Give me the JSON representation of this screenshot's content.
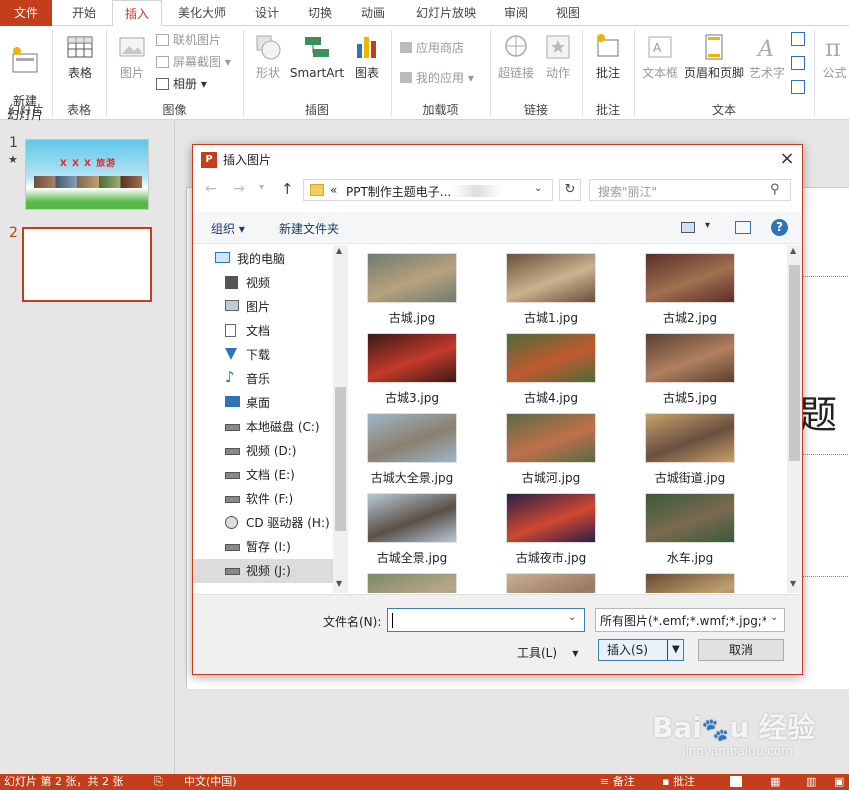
{
  "ribbon": {
    "tabs": [
      "文件",
      "开始",
      "插入",
      "美化大师",
      "设计",
      "切换",
      "动画",
      "幻灯片放映",
      "审阅",
      "视图"
    ],
    "buttons": {
      "new_slide": "新建\n幻灯片",
      "table": "表格",
      "picture": "图片",
      "online_picture": "联机图片",
      "screenshot": "屏幕截图",
      "album": "相册",
      "shapes": "形状",
      "smartart": "SmartArt",
      "chart": "图表",
      "app_store": "应用商店",
      "my_apps": "我的应用",
      "hyperlink": "超链接",
      "action": "动作",
      "comment": "批注",
      "textbox": "文本框",
      "header_footer": "页眉和页脚",
      "wordart": "艺术字",
      "formula": "公式"
    },
    "groups": [
      "幻灯片",
      "表格",
      "图像",
      "插图",
      "加载项",
      "链接",
      "批注",
      "文本"
    ]
  },
  "slides": {
    "thumb1_title": "X X X 旅游",
    "numbers": [
      "1",
      "2"
    ]
  },
  "editor": {
    "title_fragment": "题"
  },
  "dialog": {
    "title": "插入图片",
    "path_prefix": "«",
    "path": "PPT制作主题电子...",
    "search_placeholder": "搜索\"丽江\"",
    "organize": "组织",
    "new_folder": "新建文件夹",
    "tree": [
      {
        "label": "我的电脑",
        "icon": "computer-icon"
      },
      {
        "label": "视频",
        "icon": "video-folder-icon"
      },
      {
        "label": "图片",
        "icon": "picture-folder-icon"
      },
      {
        "label": "文档",
        "icon": "document-folder-icon"
      },
      {
        "label": "下载",
        "icon": "download-icon"
      },
      {
        "label": "音乐",
        "icon": "music-icon"
      },
      {
        "label": "桌面",
        "icon": "desktop-icon"
      },
      {
        "label": "本地磁盘 (C:)",
        "icon": "drive-icon"
      },
      {
        "label": "视频 (D:)",
        "icon": "drive-icon"
      },
      {
        "label": "文档 (E:)",
        "icon": "drive-icon"
      },
      {
        "label": "软件 (F:)",
        "icon": "drive-icon"
      },
      {
        "label": "CD 驱动器 (H:)",
        "icon": "cd-drive-icon"
      },
      {
        "label": "暂存 (I:)",
        "icon": "drive-icon"
      },
      {
        "label": "视频 (J:)",
        "icon": "drive-icon"
      }
    ],
    "files": [
      {
        "name": "古城.jpg",
        "color1": "#6f7c72",
        "color2": "#b7a27e"
      },
      {
        "name": "古城1.jpg",
        "color1": "#6a4e3c",
        "color2": "#c9b48f"
      },
      {
        "name": "古城2.jpg",
        "color1": "#5a2f2a",
        "color2": "#a07050"
      },
      {
        "name": "古城3.jpg",
        "color1": "#3a1a18",
        "color2": "#c43a2a"
      },
      {
        "name": "古城4.jpg",
        "color1": "#4e6a3a",
        "color2": "#c05a30"
      },
      {
        "name": "古城5.jpg",
        "color1": "#5a4030",
        "color2": "#b08060"
      },
      {
        "name": "古城大全景.jpg",
        "color1": "#9fb5c8",
        "color2": "#8a8070"
      },
      {
        "name": "古城河.jpg",
        "color1": "#5a6a48",
        "color2": "#c0704a"
      },
      {
        "name": "古城街道.jpg",
        "color1": "#c8a068",
        "color2": "#6a5040"
      },
      {
        "name": "古城全景.jpg",
        "color1": "#b9c8d6",
        "color2": "#5a5048"
      },
      {
        "name": "古城夜市.jpg",
        "color1": "#2a2048",
        "color2": "#d04830"
      },
      {
        "name": "水车.jpg",
        "color1": "#3a5a3a",
        "color2": "#7a6a50"
      },
      {
        "name": "",
        "color1": "#7a8a68",
        "color2": "#b8a888"
      },
      {
        "name": "",
        "color1": "#c8b090",
        "color2": "#9a7a60"
      },
      {
        "name": "",
        "color1": "#6a4a30",
        "color2": "#c0a070"
      }
    ],
    "filename_label": "文件名(N):",
    "filename_value": "",
    "filter": "所有图片(*.emf;*.wmf;*.jpg;*.jp",
    "tools": "工具(L)",
    "insert": "插入(S)",
    "cancel": "取消"
  },
  "status": {
    "slide_info": "幻灯片 第 2 张，共 2 张",
    "language": "中文(中国)",
    "notes": "备注",
    "comments": "批注"
  },
  "colors": {
    "accent": "#c43e1c",
    "link_blue": "#1e5799"
  }
}
